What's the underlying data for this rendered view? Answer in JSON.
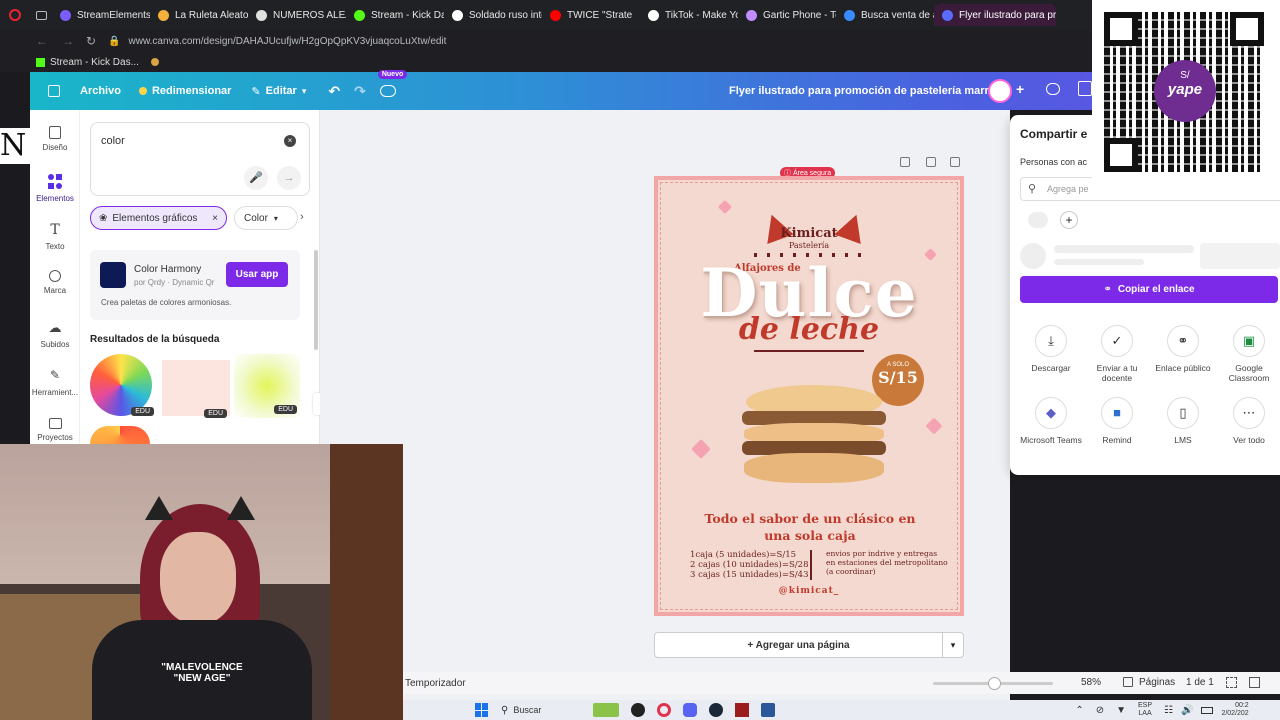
{
  "browser": {
    "tabs": [
      {
        "label": "StreamElements |",
        "color": "#7b5cff"
      },
      {
        "label": "La Ruleta Aleatoria",
        "color": "#f3b03c"
      },
      {
        "label": "NUMEROS ALEAT",
        "color": "#e0e0e0"
      },
      {
        "label": "Stream - Kick Das",
        "color": "#53fc18"
      },
      {
        "label": "Soldado ruso inter",
        "color": "#ffffff"
      },
      {
        "label": "TWICE \"Strate",
        "color": "#ff0000"
      },
      {
        "label": "TikTok - Make You",
        "color": "#ffffff"
      },
      {
        "label": "Gartic Phone - Te",
        "color": "#c08cff"
      },
      {
        "label": "Busca venta de al",
        "color": "#3a8bff"
      },
      {
        "label": "Flyer ilustrado para promo",
        "color": "#5a6bff",
        "active": true
      }
    ],
    "url": "www.canva.com/design/DAHAJUcufjw/H2gOpQpKV3vjuaqcoLuXtw/edit",
    "bookmark": "Stream - Kick Das..."
  },
  "header": {
    "archivo": "Archivo",
    "redimensionar": "Redimensionar",
    "editar": "Editar",
    "nuevo_badge": "Nuevo",
    "title": "Flyer ilustrado para promoción de pastelería marrón"
  },
  "rail": {
    "items": [
      "Diseño",
      "Elementos",
      "Texto",
      "Marca",
      "Subidos",
      "Herramient...",
      "Proyectos"
    ]
  },
  "panel": {
    "search_value": "color",
    "chip_elementos": "Elementos gráficos",
    "chip_color": "Color",
    "app_name": "Color Harmony",
    "app_by": "por Qrdy · Dynamic Qr",
    "app_button": "Usar app",
    "app_desc": "Crea paletas de colores armoniosas.",
    "results_title": "Resultados de la búsqueda",
    "edu": "EDU"
  },
  "canvas": {
    "safe_area": "Área segura",
    "add_page": "+ Agregar una página"
  },
  "flyer": {
    "brand": "Kimicat",
    "brand_sub": "Pastelería",
    "alfajores": "Alfajores de",
    "dulce": "Dulce",
    "leche": "de leche",
    "price_label": "A SOLO",
    "price": "S/15",
    "tagline": "Todo el sabor de un clásico en una sola caja",
    "offers": [
      "1caja (5 unidades)=S/15",
      "2 cajas (10 unidades)=S/28",
      "3 cajas (15 unidades)=S/43"
    ],
    "delivery": "envios por indrive y entregas en estaciones del metropolitano (a coordinar)",
    "handle": "@kimicat_"
  },
  "share": {
    "title": "Compartir e",
    "people_label": "Personas con ac",
    "search_placeholder": "Agrega pe",
    "copy_link": "Copiar el enlace",
    "options": [
      {
        "label": "Descargar",
        "icon": "download-icon"
      },
      {
        "label": "Enviar a tu docente",
        "icon": "check-circle-icon"
      },
      {
        "label": "Enlace público",
        "icon": "link-icon"
      },
      {
        "label": "Google Classroom",
        "icon": "classroom-icon"
      },
      {
        "label": "Microsoft Teams",
        "icon": "teams-icon"
      },
      {
        "label": "Remind",
        "icon": "remind-icon"
      },
      {
        "label": "LMS",
        "icon": "lms-icon"
      },
      {
        "label": "Ver todo",
        "icon": "more-icon"
      }
    ]
  },
  "qr": {
    "brand": "yape"
  },
  "overlay_letter": "N",
  "bottom": {
    "timer": "Temporizador",
    "zoom": "58%",
    "pages_label": "Páginas",
    "pages_count": "1 de 1"
  },
  "taskbar": {
    "search": "Buscar",
    "lang": "ESP",
    "lang2": "LAA",
    "time": "00:2",
    "date": "2/02/202"
  },
  "webcam": {
    "shirt_line1": "\"MALEVOLENCE",
    "shirt_line2": "\"NEW AGE\""
  },
  "colors": {
    "accent": "#7d2ae8",
    "canva_teal": "#19b6c9",
    "flyer_red": "#c0392b"
  }
}
